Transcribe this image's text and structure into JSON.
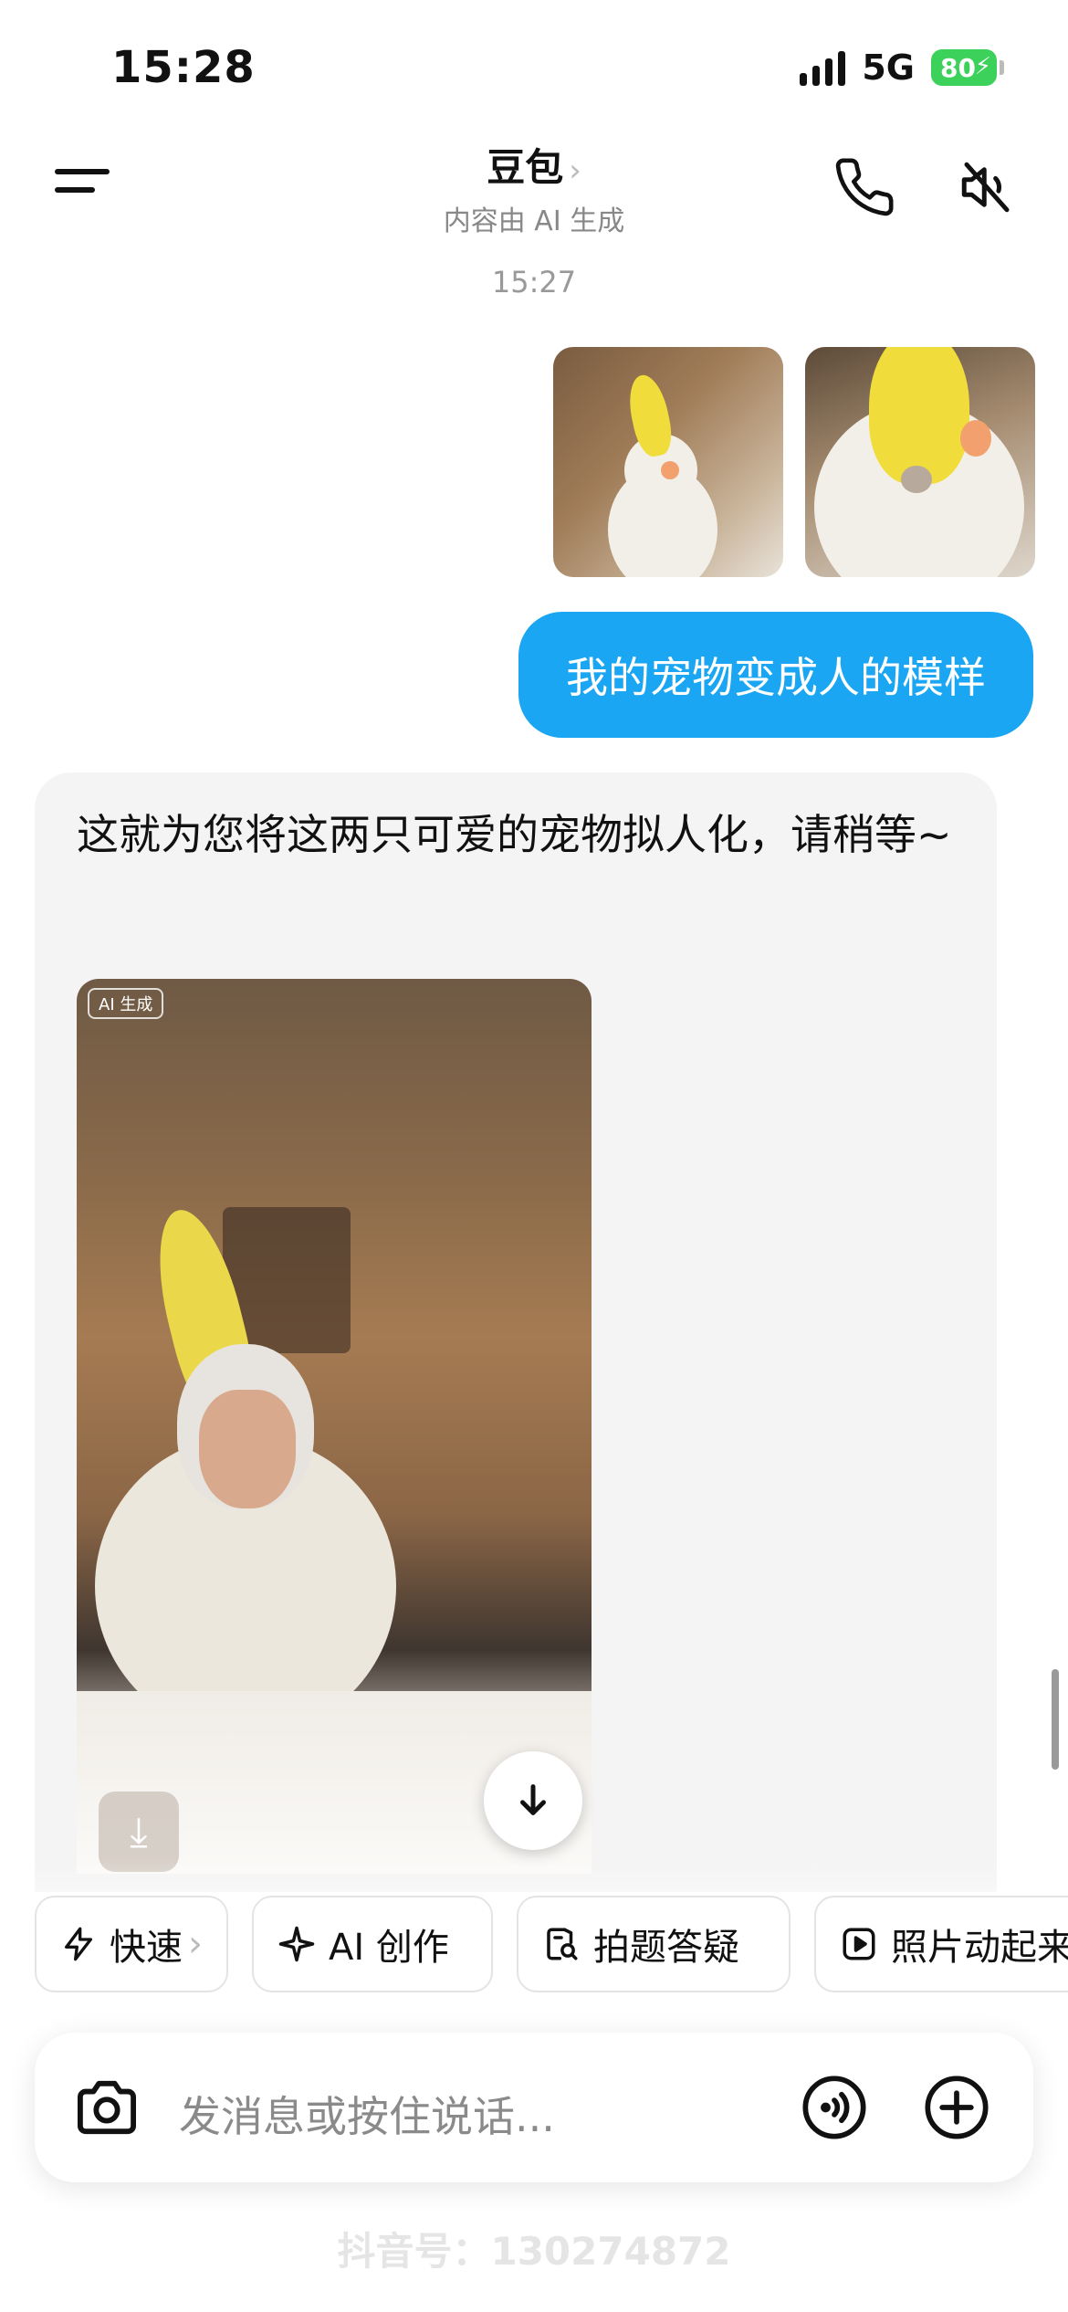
{
  "status_bar": {
    "time": "15:28",
    "network": "5G",
    "battery": "80"
  },
  "header": {
    "title": "豆包",
    "subtitle": "内容由 AI 生成"
  },
  "chat": {
    "timestamp": "15:27",
    "user_message": "我的宠物变成人的模样",
    "bot_message": "这就为您将这两只可爱的宠物拟人化，请稍等~",
    "image_badge": "AI 生成"
  },
  "quick_actions": [
    {
      "label": "快速",
      "icon": "lightning-icon"
    },
    {
      "label": "AI 创作",
      "icon": "sparkle-icon"
    },
    {
      "label": "拍题答疑",
      "icon": "search-doc-icon"
    },
    {
      "label": "照片动起来",
      "icon": "play-icon"
    }
  ],
  "input": {
    "placeholder": "发消息或按住说话..."
  },
  "watermark": "抖音号：130274872",
  "colors": {
    "user_bubble": "#1aa6f2",
    "bot_bubble": "#f4f4f5",
    "battery": "#3bd15a"
  }
}
